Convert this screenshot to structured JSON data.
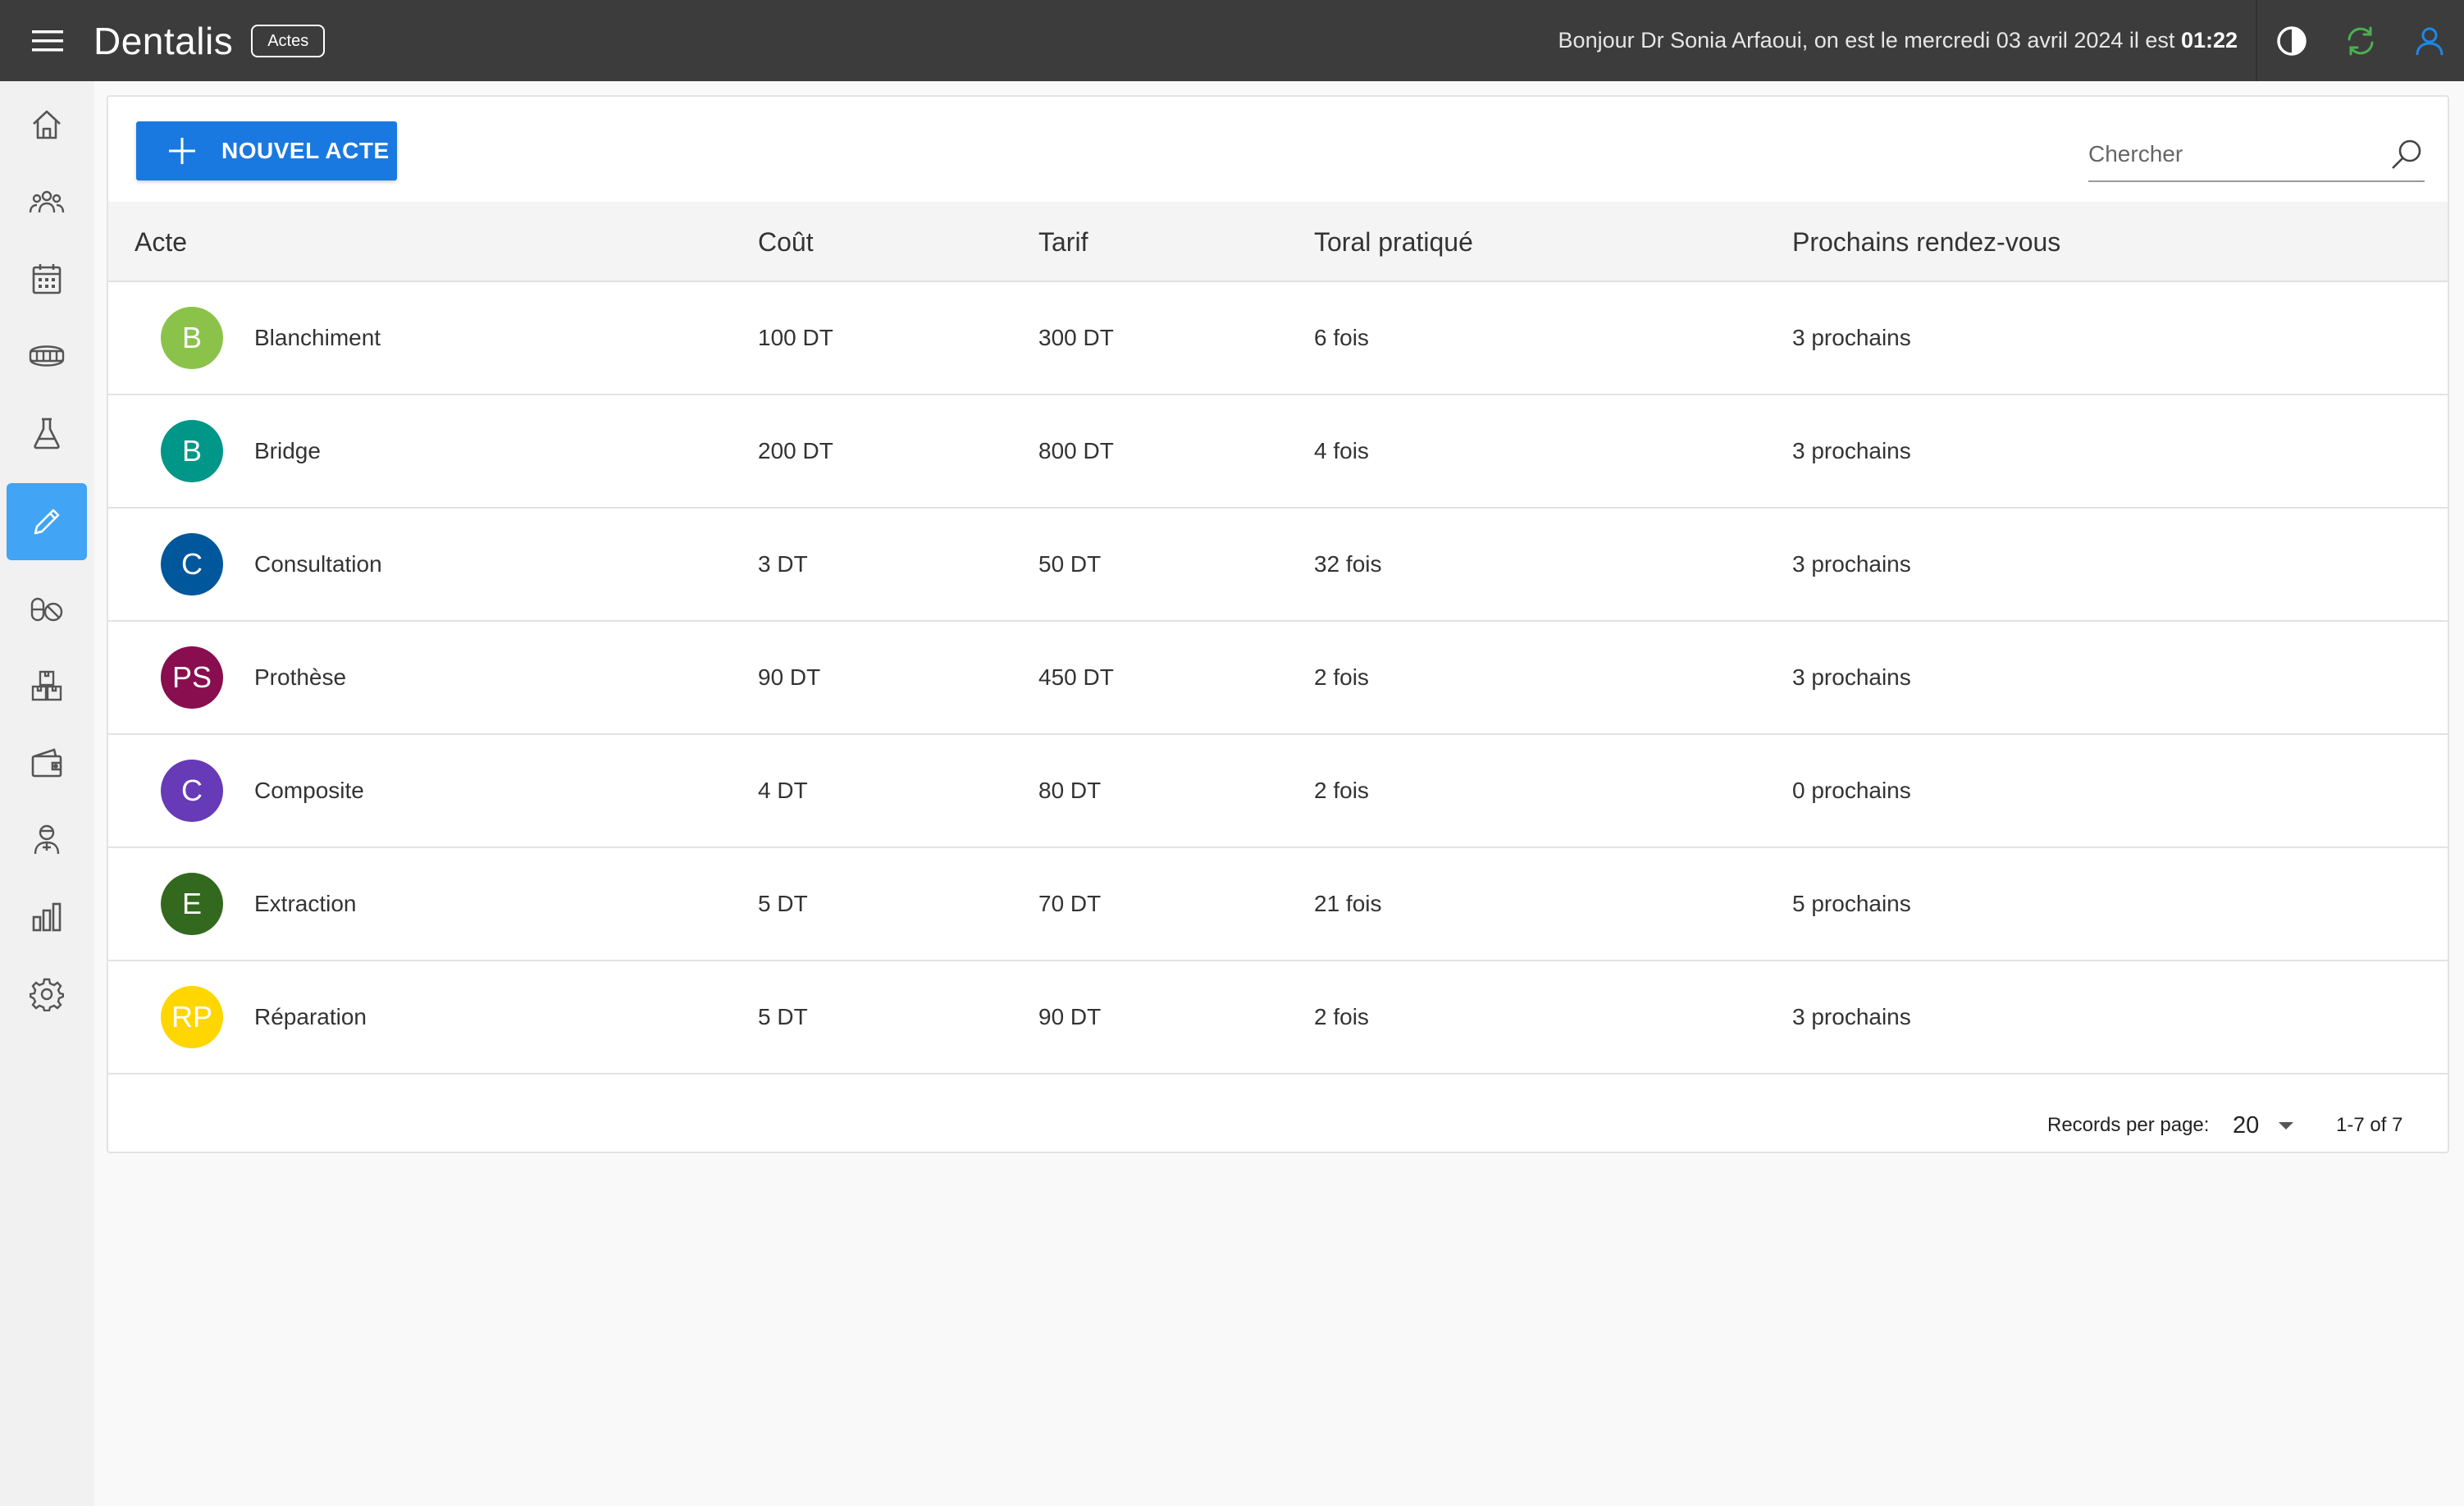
{
  "header": {
    "app_title": "Dentalis",
    "page_chip": "Actes",
    "greeting_prefix": "Bonjour Dr Sonia Arfaoui, on est le mercredi 03 avril 2024 il est ",
    "time": "01:22"
  },
  "colors": {
    "topbar": "#3c3c3c",
    "accent": "#1a79e0",
    "sidebar_active": "#42a4f5",
    "refresh_icon": "#4caf50",
    "user_icon": "#1e88e5"
  },
  "sidebar": {
    "items": [
      {
        "icon": "home-icon"
      },
      {
        "icon": "patients-icon"
      },
      {
        "icon": "calendar-icon"
      },
      {
        "icon": "teeth-icon"
      },
      {
        "icon": "lab-flask-icon"
      },
      {
        "icon": "actes-pencil-icon",
        "active": true
      },
      {
        "icon": "medication-icon"
      },
      {
        "icon": "inventory-boxes-icon"
      },
      {
        "icon": "wallet-icon"
      },
      {
        "icon": "staff-icon"
      },
      {
        "icon": "statistics-icon"
      },
      {
        "icon": "settings-gear-icon"
      }
    ]
  },
  "toolbar": {
    "new_button_label": "NOUVEL ACTE",
    "search_placeholder": "Chercher"
  },
  "table": {
    "columns": [
      "Acte",
      "Coût",
      "Tarif",
      "Toral pratiqué",
      "Prochains rendez-vous"
    ],
    "rows": [
      {
        "initials": "B",
        "avatar_color": "#8bc34a",
        "acte": "Blanchiment",
        "cout": "100 DT",
        "tarif": "300 DT",
        "total": "6 fois",
        "prochains": "3 prochains"
      },
      {
        "initials": "B",
        "avatar_color": "#009688",
        "acte": "Bridge",
        "cout": "200 DT",
        "tarif": "800 DT",
        "total": "4 fois",
        "prochains": "3 prochains"
      },
      {
        "initials": "C",
        "avatar_color": "#01579b",
        "acte": "Consultation",
        "cout": "3 DT",
        "tarif": "50 DT",
        "total": "32 fois",
        "prochains": "3 prochains"
      },
      {
        "initials": "PS",
        "avatar_color": "#880e4f",
        "acte": "Prothèse",
        "cout": "90 DT",
        "tarif": "450 DT",
        "total": "2 fois",
        "prochains": "3 prochains"
      },
      {
        "initials": "C",
        "avatar_color": "#673ab7",
        "acte": "Composite",
        "cout": "4 DT",
        "tarif": "80 DT",
        "total": "2 fois",
        "prochains": "0 prochains"
      },
      {
        "initials": "E",
        "avatar_color": "#33691e",
        "acte": "Extraction",
        "cout": "5 DT",
        "tarif": "70 DT",
        "total": "21 fois",
        "prochains": "5 prochains"
      },
      {
        "initials": "RP",
        "avatar_color": "#ffd600",
        "acte": "Réparation",
        "cout": "5 DT",
        "tarif": "90 DT",
        "total": "2 fois",
        "prochains": "3 prochains"
      }
    ]
  },
  "pagination": {
    "records_per_page_label": "Records per page:",
    "records_per_page_value": "20",
    "range": "1-7 of 7"
  }
}
